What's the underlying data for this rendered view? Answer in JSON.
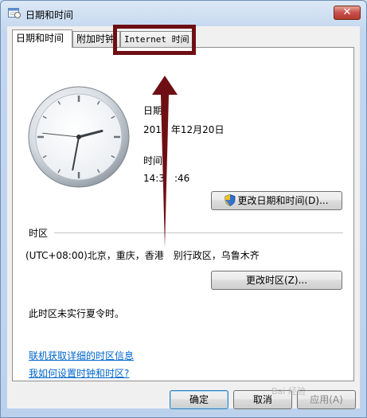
{
  "window": {
    "title": "日期和时间",
    "close_label": "✕"
  },
  "tabs": [
    {
      "label": "日期和时间",
      "active": true
    },
    {
      "label": "附加时钟",
      "active": false
    },
    {
      "label": "Internet 时间",
      "active": false
    }
  ],
  "datetime": {
    "date_label": "日期",
    "date_label_visible": "日期",
    "date_value": "2015年12月20日",
    "date_value_visible": "201",
    "date_value_suffix": "年12月20日",
    "time_label": "时间",
    "time_label_visible": "时间",
    "time_value": "14:31:46",
    "time_value_prefix": "14:3",
    "time_value_suffix": ":46",
    "change_datetime_button": "更改日期和时间(D)..."
  },
  "timezone": {
    "section_label": "时区",
    "value_prefix": "(UTC+08:00)北京，重庆，香港",
    "value_suffix": "别行政区，乌鲁木齐",
    "change_timezone_button": "更改时区(Z)...",
    "dst_note": "此时区未实行夏令时。"
  },
  "links": {
    "online_info": "联机获取详细的时区信息",
    "how_to": "我如何设置时钟和时区?"
  },
  "footer": {
    "ok_button": "确定",
    "cancel_button": "取消",
    "apply_button": "应用(A)"
  },
  "clock": {
    "hour": 14,
    "minute": 31,
    "second": 46
  },
  "colors": {
    "annotation": "#6e0f14",
    "link": "#0066cc"
  },
  "watermark": "Bai 经验"
}
